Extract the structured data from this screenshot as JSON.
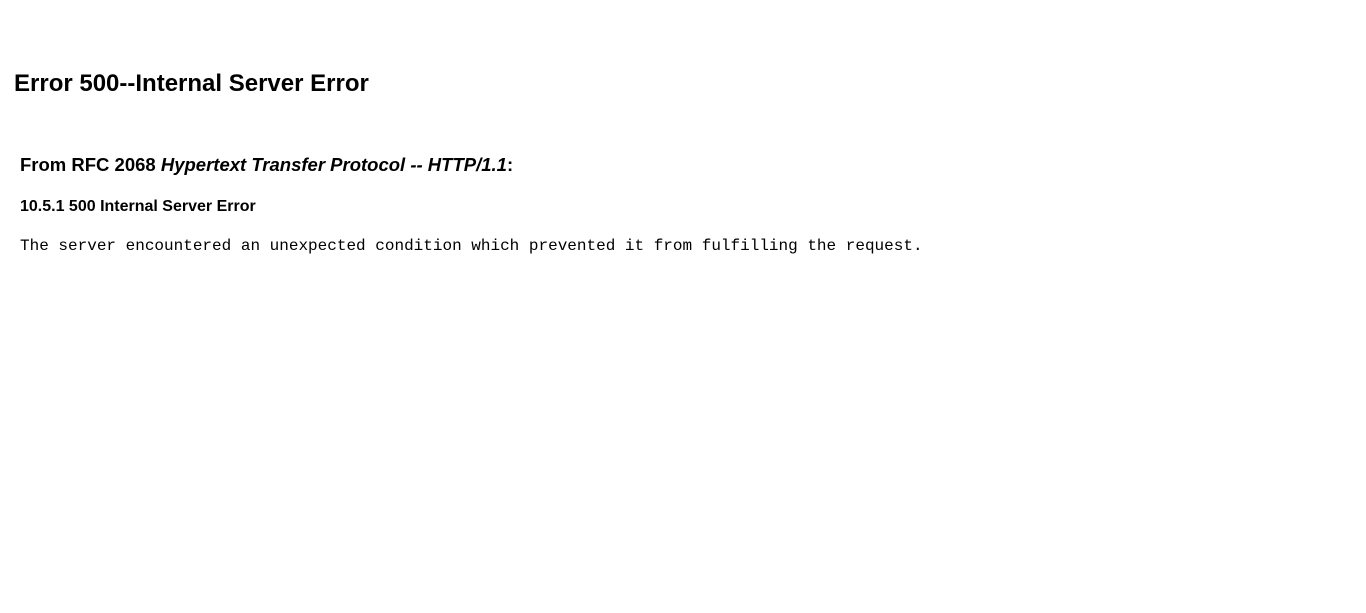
{
  "page": {
    "title": "Error 500--Internal Server Error"
  },
  "rfc": {
    "prefix": "From RFC 2068 ",
    "document_name": "Hypertext Transfer Protocol -- HTTP/1.1",
    "suffix": ":"
  },
  "section": {
    "heading": "10.5.1 500 Internal Server Error",
    "description": "The server encountered an unexpected condition which prevented it from fulfilling the request."
  }
}
